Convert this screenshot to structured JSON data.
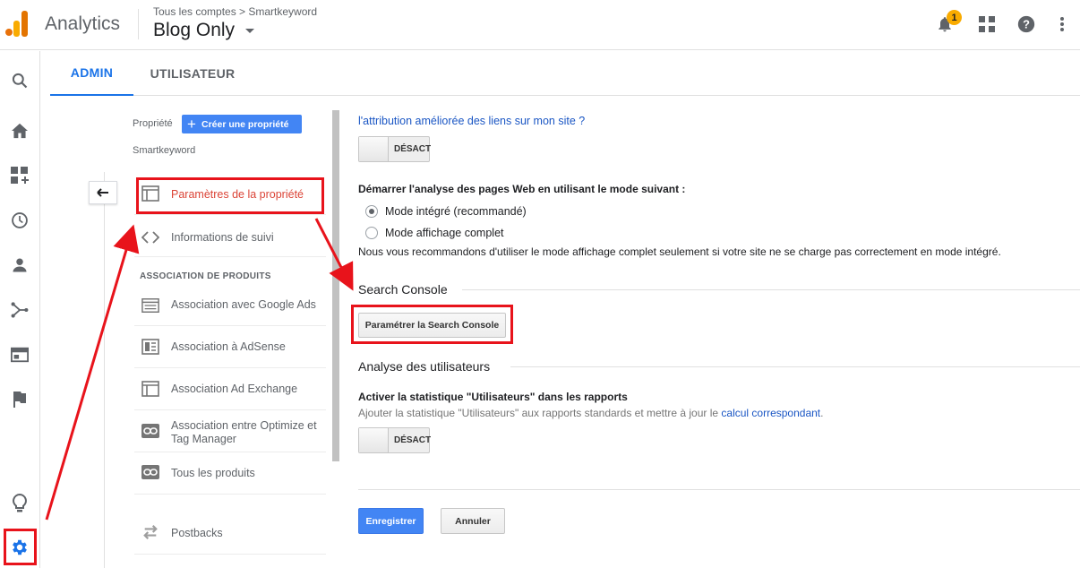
{
  "header": {
    "app_title": "Analytics",
    "breadcrumb": "Tous les comptes > Smartkeyword",
    "account": "Blog Only",
    "notification_count": "1"
  },
  "tabs": [
    {
      "label": "ADMIN",
      "active": true
    },
    {
      "label": "UTILISATEUR",
      "active": false
    }
  ],
  "property": {
    "label": "Propriété",
    "create_button": "Créer une propriété",
    "name": "Smartkeyword"
  },
  "menu": {
    "items": [
      {
        "label": "Paramètres de la propriété",
        "icon": "layout-icon",
        "active": true
      },
      {
        "label": "Informations de suivi",
        "icon": "code-icon"
      }
    ],
    "section_assoc": "ASSOCIATION DE PRODUITS",
    "assoc_items": [
      {
        "label": "Association avec Google Ads",
        "icon": "ads-icon"
      },
      {
        "label": "Association à AdSense",
        "icon": "adsense-icon"
      },
      {
        "label": "Association Ad Exchange",
        "icon": "adexchange-icon"
      },
      {
        "label": "Association entre Optimize et Tag Manager",
        "icon": "link-icon"
      },
      {
        "label": "Tous les produits",
        "icon": "link-icon"
      }
    ],
    "postbacks": "Postbacks"
  },
  "content": {
    "attribution_link": "l'attribution améliorée des liens sur mon site ?",
    "toggle_off": "DÉSACT",
    "analysis_mode_title": "Démarrer l'analyse des pages Web en utilisant le mode suivant :",
    "radio_integrated": "Mode intégré (recommandé)",
    "radio_full": "Mode affichage complet",
    "recommendation": "Nous vous recommandons d'utiliser le mode affichage complet seulement si votre site ne se charge pas correctement en mode intégré.",
    "search_console_title": "Search Console",
    "search_console_button": "Paramétrer la Search Console",
    "user_analysis_title": "Analyse des utilisateurs",
    "users_stat_title": "Activer la statistique \"Utilisateurs\" dans les rapports",
    "users_stat_desc": "Ajouter la statistique \"Utilisateurs\" aux rapports standards et mettre à jour le",
    "users_stat_link": "calcul correspondant",
    "save_button": "Enregistrer",
    "cancel_button": "Annuler"
  },
  "colors": {
    "accent": "#1a73e8",
    "button_blue": "#4285f4",
    "annotation_red": "#e8131b",
    "active_menu": "#db4437"
  }
}
